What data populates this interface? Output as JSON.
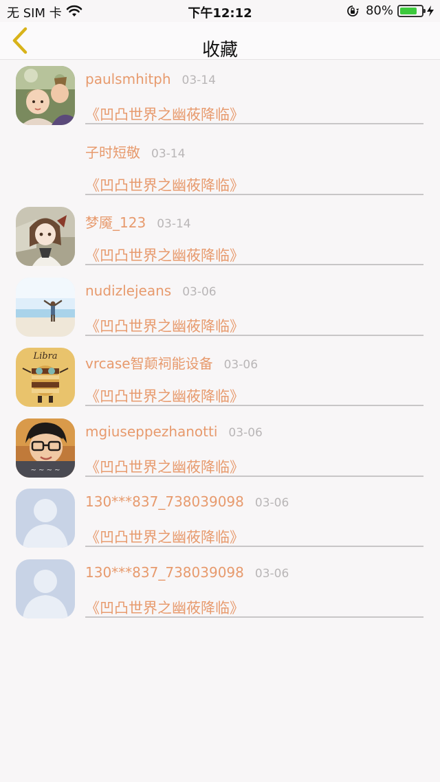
{
  "status_bar": {
    "carrier": "无 SIM 卡",
    "time": "下午12:12",
    "battery_percent": "80%",
    "battery_level": 0.8,
    "icons": [
      "wifi-icon",
      "rotation-lock-icon",
      "battery-icon",
      "charging-icon"
    ]
  },
  "nav": {
    "title": "收藏",
    "back_icon": "chevron-left-icon",
    "accent_color": "#d8b31a"
  },
  "favorites": [
    {
      "username": "paulsmhitph",
      "date": "03-14",
      "title": "《凹凸世界之幽莜降临》",
      "avatar": "photo-kids"
    },
    {
      "username": "子时短敬",
      "date": "03-14",
      "title": "《凹凸世界之幽莜降临》",
      "avatar": "none"
    },
    {
      "username": "梦魇_123",
      "date": "03-14",
      "title": "《凹凸世界之幽莜降临》",
      "avatar": "anime-girl"
    },
    {
      "username": "nudizlejeans",
      "date": "03-06",
      "title": "《凹凸世界之幽莜降临》",
      "avatar": "beach"
    },
    {
      "username": "vrcase智颠祠能设备",
      "date": "03-06",
      "title": "《凹凸世界之幽莜降临》",
      "avatar": "libra"
    },
    {
      "username": "mgiuseppezhanotti",
      "date": "03-06",
      "title": "《凹凸世界之幽莜降临》",
      "avatar": "boy-glasses"
    },
    {
      "username": "130***837_738039098",
      "date": "03-06",
      "title": "《凹凸世界之幽莜降临》",
      "avatar": "default-user"
    },
    {
      "username": "130***837_738039098",
      "date": "03-06",
      "title": "《凹凸世界之幽莜降临》",
      "avatar": "default-user"
    }
  ],
  "colors": {
    "name_color": "#e79a6d",
    "date_color": "#b9b6b7",
    "background": "#f8f6f7"
  }
}
